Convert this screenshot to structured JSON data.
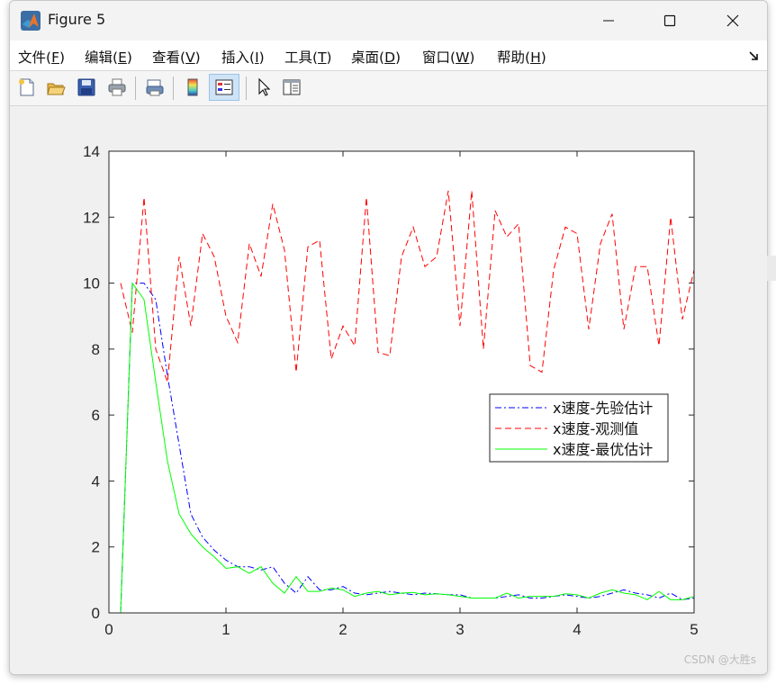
{
  "window": {
    "title": "Figure 5"
  },
  "menu": [
    {
      "label": "文件(",
      "key": "F",
      "tail": ")"
    },
    {
      "label": "编辑(",
      "key": "E",
      "tail": ")"
    },
    {
      "label": "查看(",
      "key": "V",
      "tail": ")"
    },
    {
      "label": "插入(",
      "key": "I",
      "tail": ")"
    },
    {
      "label": "工具(",
      "key": "T",
      "tail": ")"
    },
    {
      "label": "桌面(",
      "key": "D",
      "tail": ")"
    },
    {
      "label": "窗口(",
      "key": "W",
      "tail": ")"
    },
    {
      "label": "帮助(",
      "key": "H",
      "tail": ")"
    }
  ],
  "toolbar": {
    "icons": [
      "new-figure-icon",
      "open-file-icon",
      "save-icon",
      "print-icon",
      "print-preview-icon",
      "colorbar-icon",
      "legend-icon",
      "edit-plot-arrow-icon",
      "property-inspector-icon"
    ],
    "active": "legend-icon"
  },
  "watermark": "CSDN @大胜s",
  "chart_data": {
    "type": "line",
    "xlim": [
      0,
      5
    ],
    "ylim": [
      0,
      14
    ],
    "xticks": [
      "0",
      "1",
      "2",
      "3",
      "4",
      "5"
    ],
    "yticks": [
      "0",
      "2",
      "4",
      "6",
      "8",
      "10",
      "12",
      "14"
    ],
    "grid": false,
    "legend_position": "center-right",
    "x": [
      0.1,
      0.2,
      0.3,
      0.4,
      0.5,
      0.6,
      0.7,
      0.8,
      0.9,
      1.0,
      1.1,
      1.2,
      1.3,
      1.4,
      1.5,
      1.6,
      1.7,
      1.8,
      1.9,
      2.0,
      2.1,
      2.2,
      2.3,
      2.4,
      2.5,
      2.6,
      2.7,
      2.8,
      2.9,
      3.0,
      3.1,
      3.2,
      3.3,
      3.4,
      3.5,
      3.6,
      3.7,
      3.8,
      3.9,
      4.0,
      4.1,
      4.2,
      4.3,
      4.4,
      4.5,
      4.6,
      4.7,
      4.8,
      4.9,
      5.0
    ],
    "series": [
      {
        "name": "x速度-先验估计",
        "color": "#0000ff",
        "style": "dashdot",
        "values": [
          0,
          10.0,
          10.0,
          9.5,
          7.2,
          5.1,
          3.0,
          2.3,
          1.9,
          1.6,
          1.4,
          1.4,
          1.3,
          1.4,
          0.9,
          0.6,
          1.1,
          0.7,
          0.7,
          0.8,
          0.6,
          0.55,
          0.6,
          0.65,
          0.6,
          0.55,
          0.6,
          0.58,
          0.55,
          0.55,
          0.45,
          0.45,
          0.45,
          0.5,
          0.55,
          0.45,
          0.45,
          0.5,
          0.55,
          0.5,
          0.45,
          0.5,
          0.6,
          0.7,
          0.6,
          0.55,
          0.45,
          0.6,
          0.4,
          0.45
        ]
      },
      {
        "name": "x速度-观测值",
        "color": "#ff0000",
        "style": "dashed",
        "values": [
          10.0,
          8.5,
          12.6,
          8.0,
          7.0,
          10.8,
          8.7,
          11.5,
          10.8,
          9.0,
          8.2,
          11.2,
          10.2,
          12.4,
          11.0,
          7.3,
          11.1,
          11.3,
          7.7,
          8.7,
          8.1,
          12.6,
          7.9,
          7.8,
          10.8,
          11.7,
          10.5,
          10.8,
          12.8,
          8.7,
          12.8,
          8.0,
          12.2,
          11.4,
          11.8,
          7.5,
          7.3,
          10.4,
          11.7,
          11.5,
          8.6,
          11.2,
          12.1,
          8.6,
          10.5,
          10.5,
          8.1,
          12.0,
          8.9,
          10.4
        ]
      },
      {
        "name": "x速度-最优估计",
        "color": "#00ff00",
        "style": "solid",
        "values": [
          0,
          10.0,
          9.5,
          7.0,
          4.6,
          3.0,
          2.4,
          2.0,
          1.7,
          1.35,
          1.4,
          1.2,
          1.4,
          0.9,
          0.6,
          1.1,
          0.65,
          0.65,
          0.75,
          0.7,
          0.5,
          0.6,
          0.65,
          0.55,
          0.6,
          0.62,
          0.55,
          0.58,
          0.55,
          0.5,
          0.45,
          0.45,
          0.45,
          0.6,
          0.45,
          0.5,
          0.5,
          0.5,
          0.58,
          0.55,
          0.45,
          0.6,
          0.7,
          0.6,
          0.55,
          0.4,
          0.65,
          0.4,
          0.4,
          0.5
        ]
      }
    ]
  }
}
